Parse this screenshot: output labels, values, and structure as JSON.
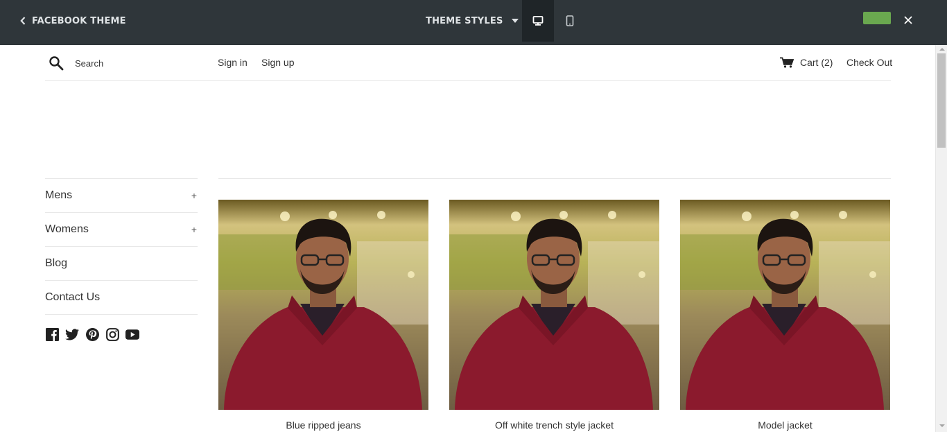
{
  "editor": {
    "back_label": "FACEBOOK THEME",
    "theme_styles_label": "THEME STYLES",
    "save_color": "#6aa84f",
    "bar_color": "#2f363a"
  },
  "header": {
    "search_placeholder": "Search",
    "sign_in": "Sign in",
    "sign_up": "Sign up",
    "cart_label": "Cart (2)",
    "checkout_label": "Check Out"
  },
  "sidebar": {
    "items": [
      {
        "label": "Mens",
        "expand": "+"
      },
      {
        "label": "Womens",
        "expand": "+"
      },
      {
        "label": "Blog"
      },
      {
        "label": "Contact Us"
      }
    ],
    "social_icons": [
      "facebook-icon",
      "twitter-icon",
      "pinterest-icon",
      "instagram-icon",
      "youtube-icon"
    ]
  },
  "products": [
    {
      "title": "Blue ripped jeans"
    },
    {
      "title": "Off white trench style jacket"
    },
    {
      "title": "Model jacket"
    }
  ]
}
